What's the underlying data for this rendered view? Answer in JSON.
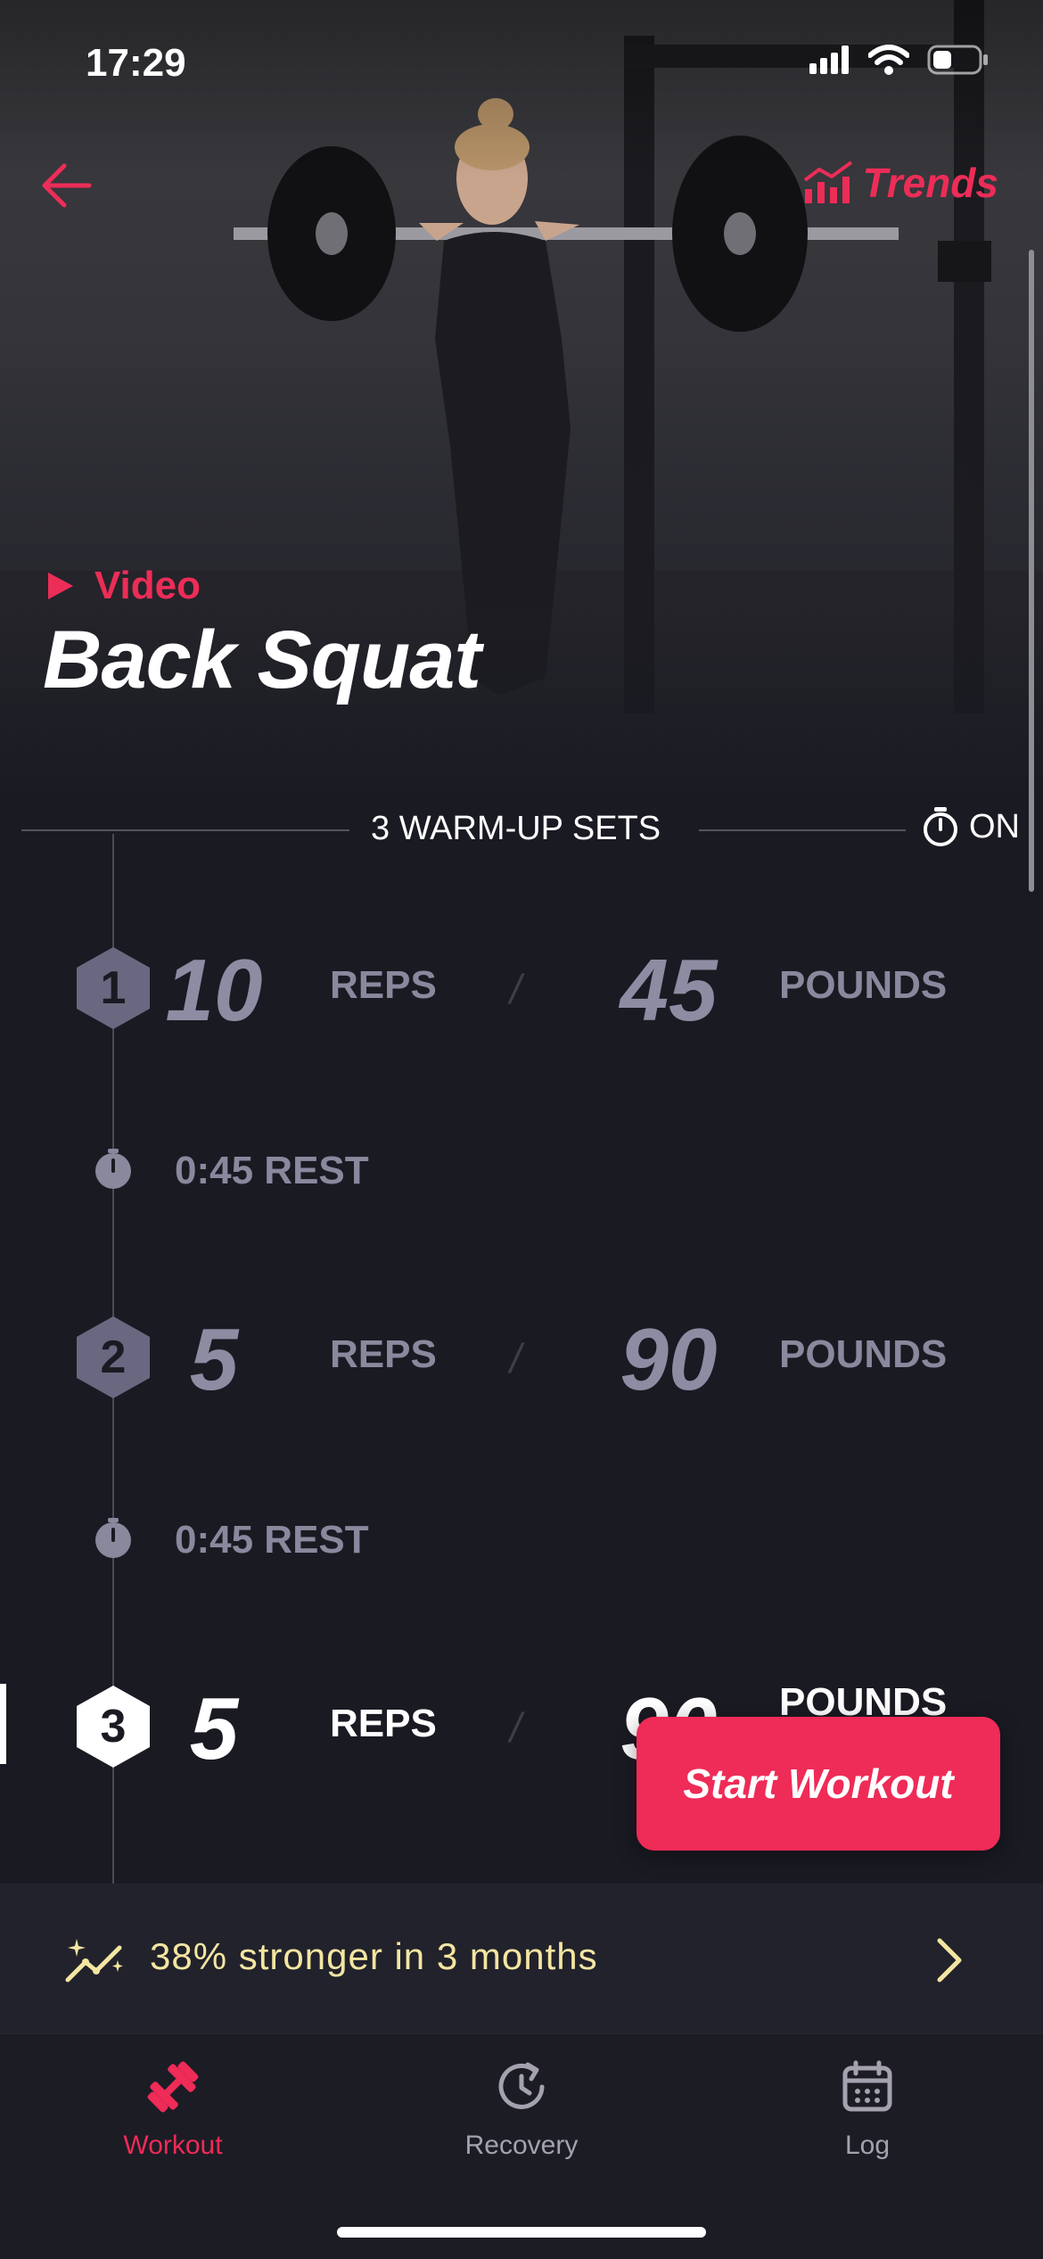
{
  "status_bar": {
    "time": "17:29"
  },
  "header": {
    "back_icon": "arrow-left-icon",
    "trends_label": "Trends",
    "trends_icon": "bar-chart-trend-icon"
  },
  "hero": {
    "video_label": "Video",
    "title": "Back Squat"
  },
  "warmup": {
    "label": "3 WARM-UP SETS",
    "timer_state": "ON",
    "timer_icon": "stopwatch-icon"
  },
  "sets": [
    {
      "number": "1",
      "reps": "10",
      "reps_label": "REPS",
      "separator": "/",
      "pounds": "45",
      "pounds_label": "POUNDS"
    },
    {
      "number": "2",
      "reps": "5",
      "reps_label": "REPS",
      "separator": "/",
      "pounds": "90",
      "pounds_label": "POUNDS"
    },
    {
      "number": "3",
      "reps": "5",
      "reps_label": "REPS",
      "separator": "/",
      "pounds": "90",
      "pounds_label": "POUNDS"
    }
  ],
  "rests": [
    {
      "text": "0:45 REST"
    },
    {
      "text": "0:45 REST"
    }
  ],
  "start_button": {
    "label": "Start Workout"
  },
  "banner": {
    "text": "38% stronger in 3 months",
    "icon": "sparkle-trend-icon"
  },
  "tabs": [
    {
      "label": "Workout",
      "icon": "dumbbell-icon",
      "active": true
    },
    {
      "label": "Recovery",
      "icon": "recovery-clock-icon",
      "active": false
    },
    {
      "label": "Log",
      "icon": "calendar-icon",
      "active": false
    }
  ],
  "colors": {
    "accent": "#ef2b57",
    "background": "#1a1a23",
    "muted_text": "#8a889d",
    "banner_text": "#f4e6a1"
  }
}
